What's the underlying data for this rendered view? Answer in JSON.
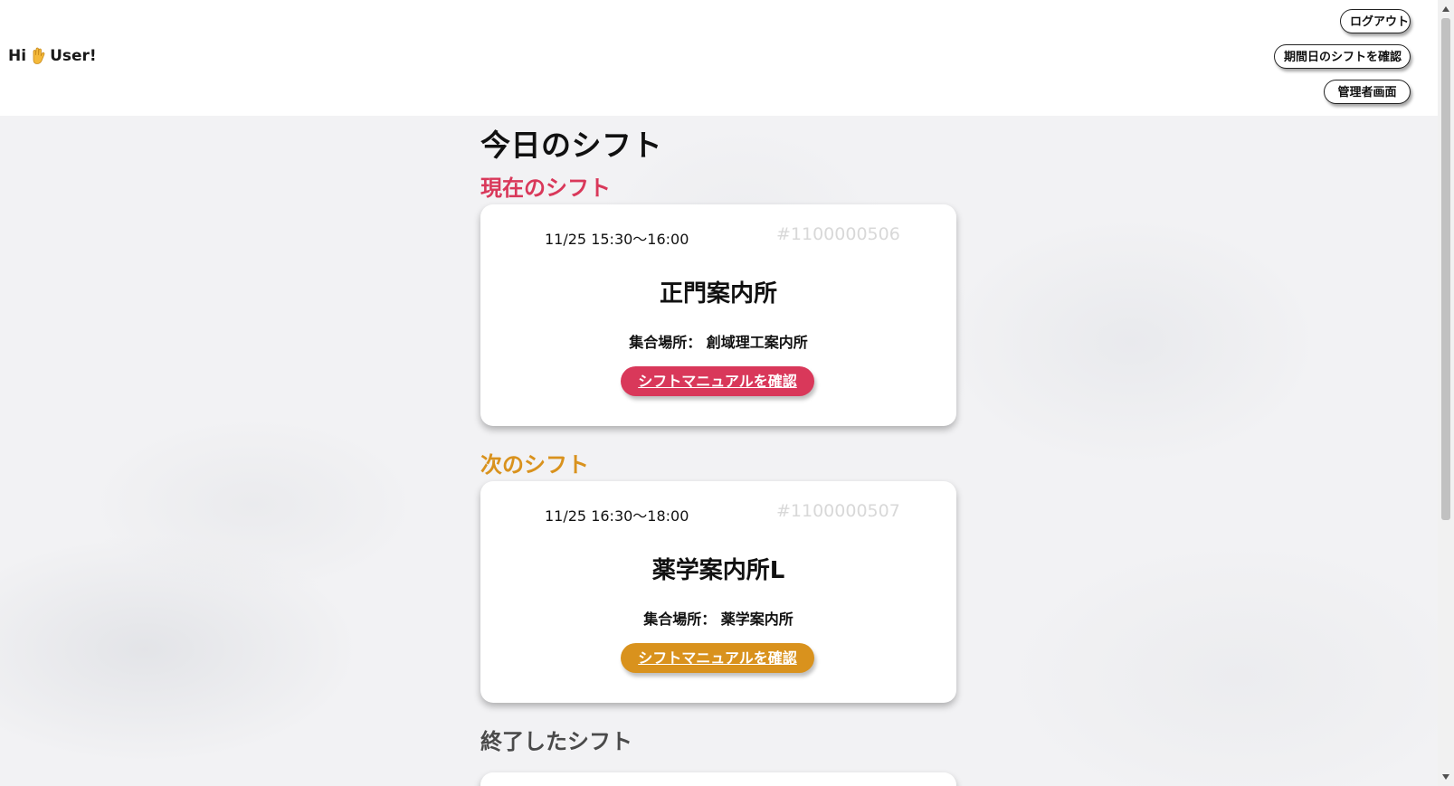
{
  "header": {
    "greeting_prefix": "Hi",
    "greeting_suffix": "User!",
    "wave_icon": "waving-hand-icon",
    "logout_label": "ログアウト",
    "period_shifts_label": "期間日のシフトを確認",
    "admin_label": "管理者画面"
  },
  "main": {
    "title": "今日のシフト",
    "sections": {
      "current": {
        "title": "現在のシフト",
        "color": "#d9385a",
        "card": {
          "time": "11/25 15:30〜16:00",
          "id": "#1100000506",
          "place": "正門案内所",
          "meeting": "集合場所： 創域理工案内所",
          "button_label": "シフトマニュアルを確認"
        }
      },
      "next": {
        "title": "次のシフト",
        "color": "#d9921d",
        "card": {
          "time": "11/25 16:30〜18:00",
          "id": "#1100000507",
          "place": "薬学案内所L",
          "meeting": "集合場所： 薬学案内所",
          "button_label": "シフトマニュアルを確認"
        }
      },
      "done": {
        "title": "終了したシフト",
        "color": "#4a4a4a"
      }
    }
  }
}
